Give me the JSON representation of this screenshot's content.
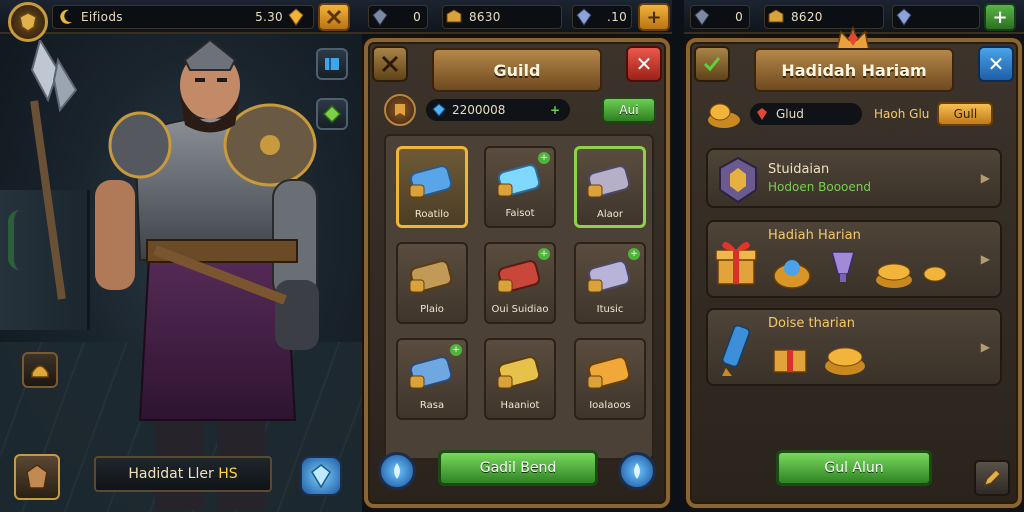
{
  "hero_screen": {
    "topbar": {
      "name_label": "Eifiods",
      "currency_value": "5.30"
    },
    "hero_name": {
      "prefix": "Hadidat Ller",
      "suffix": "HS"
    }
  },
  "guild_topbar": {
    "currency_left": "0",
    "currency_mid": "8630",
    "currency_right": ".10"
  },
  "daily_topbar": {
    "currency_left": "0",
    "currency_mid": "8620"
  },
  "guild_panel": {
    "title": "Guild",
    "gem_value": "2200008",
    "add_button": "Aui",
    "slots": [
      {
        "label": "Roatilo",
        "state": "selected-gold"
      },
      {
        "label": "Faisot",
        "state": "badge"
      },
      {
        "label": "Alaor",
        "state": "selected-green"
      },
      {
        "label": "Plaio",
        "state": "normal"
      },
      {
        "label": "Oui Suidiao",
        "state": "badge"
      },
      {
        "label": "Itusic",
        "state": "badge"
      },
      {
        "label": "Rasa",
        "state": "badge"
      },
      {
        "label": "Haaniot",
        "state": "normal"
      },
      {
        "label": "Ioalaoos",
        "state": "normal"
      }
    ],
    "cta": "Gadil Bend"
  },
  "daily_panel": {
    "title": "Hadidah Hariam",
    "field_value": "Glud",
    "side_label": "Haoh Glu",
    "side_button": "Gull",
    "rows": [
      {
        "title": "Stuidaian",
        "subtitle": "Hodoen Boooend"
      },
      {
        "title": "Hadiah Harian"
      },
      {
        "title": "Doise tharian"
      }
    ],
    "cta": "Gul Alun"
  }
}
